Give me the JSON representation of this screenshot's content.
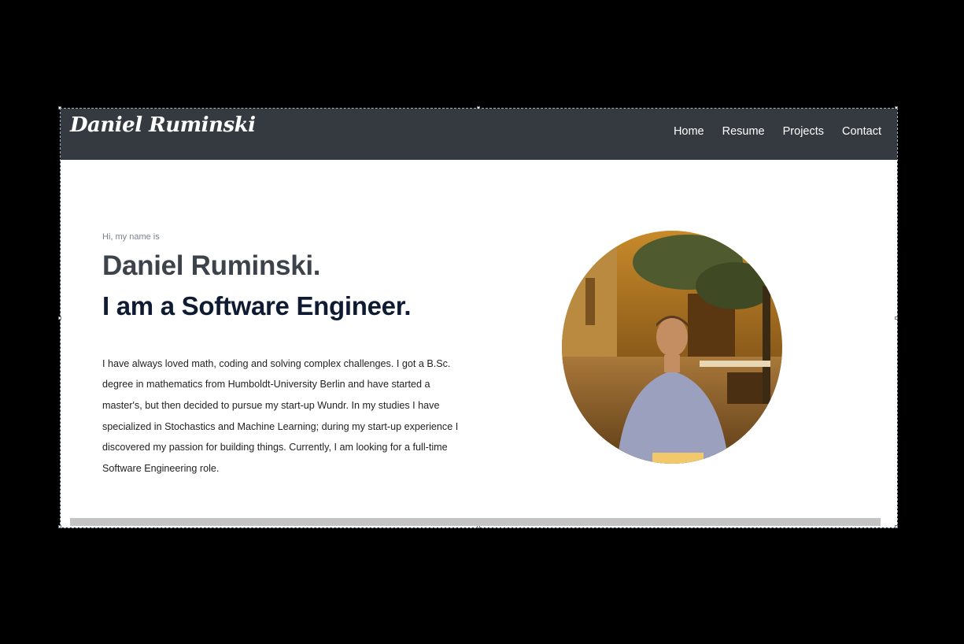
{
  "navbar": {
    "brand": "Daniel Ruminski",
    "links": [
      "Home",
      "Resume",
      "Projects",
      "Contact"
    ]
  },
  "hero": {
    "greeting": "Hi, my name is",
    "name": "Daniel Ruminski.",
    "role": "I am a Software Engineer.",
    "bio": "I have always loved math, coding and solving complex challenges. I got a B.Sc. degree in mathematics from Humboldt-University Berlin and have started a master's, but then decided to pursue my start-up Wundr. In my studies I have specialized in Stochastics and Machine Learning; during my start-up experience I discovered my passion for building things. Currently, I am looking for a full-time Software Engineering role."
  },
  "colors": {
    "navbar_bg": "#343a40",
    "name": "#3d434b",
    "role": "#0f1b33"
  }
}
